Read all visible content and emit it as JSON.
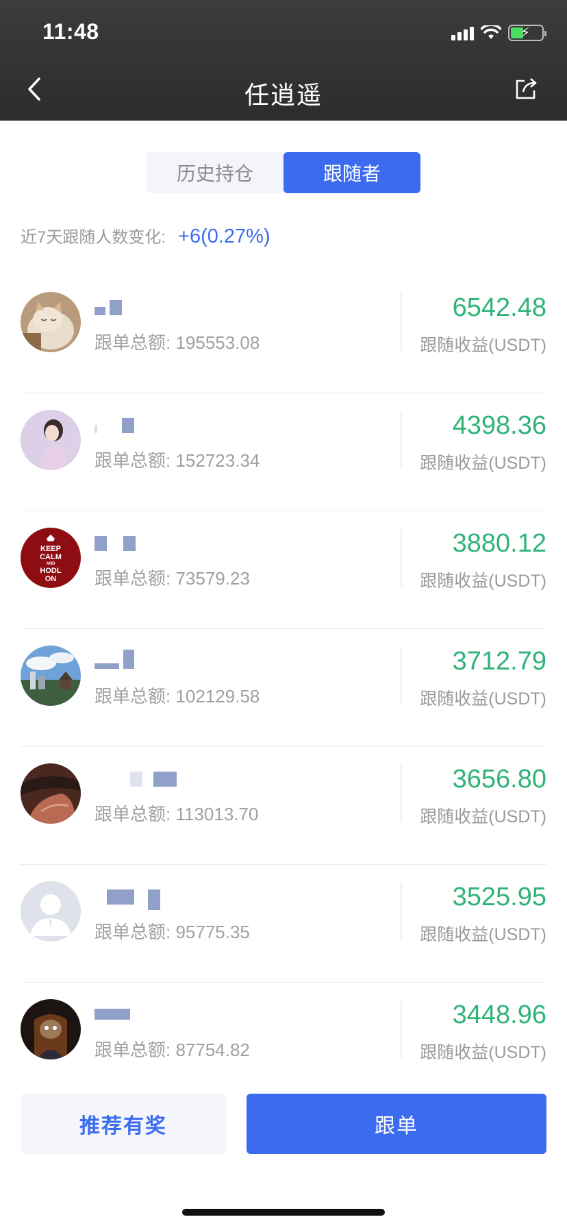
{
  "status_bar": {
    "time": "11:48"
  },
  "header": {
    "title": "任逍遥"
  },
  "tabs": [
    {
      "label": "历史持仓",
      "active": false
    },
    {
      "label": "跟随者",
      "active": true
    }
  ],
  "follower_change": {
    "label": "近7天跟随人数变化:",
    "value": "+6(0.27%)"
  },
  "followers": [
    {
      "amount": "跟单总额: 195553.08",
      "profit": "6542.48",
      "profit_label": "跟随收益(USDT)",
      "avatar": "cat-avatar"
    },
    {
      "amount": "跟单总额: 152723.34",
      "profit": "4398.36",
      "profit_label": "跟随收益(USDT)",
      "avatar": "girl-avatar"
    },
    {
      "amount": "跟单总额: 73579.23",
      "profit": "3880.12",
      "profit_label": "跟随收益(USDT)",
      "avatar": "keep-calm-avatar",
      "avatar_text": [
        "KEEP",
        "CALM",
        "AND",
        "HODL",
        "ON"
      ]
    },
    {
      "amount": "跟单总额: 102129.58",
      "profit": "3712.79",
      "profit_label": "跟随收益(USDT)",
      "avatar": "city-avatar"
    },
    {
      "amount": "跟单总额: 113013.70",
      "profit": "3656.80",
      "profit_label": "跟随收益(USDT)",
      "avatar": "car-interior-avatar"
    },
    {
      "amount": "跟单总额: 95775.35",
      "profit": "3525.95",
      "profit_label": "跟随收益(USDT)",
      "avatar": "default-avatar"
    },
    {
      "amount": "跟单总额: 87754.82",
      "profit": "3448.96",
      "profit_label": "跟随收益(USDT)",
      "avatar": "character-avatar"
    }
  ],
  "buttons": {
    "refer": "推荐有奖",
    "follow": "跟单"
  },
  "colors": {
    "accent": "#3b6cf0",
    "profit": "#2fb378",
    "header": "#2c2c2e"
  }
}
